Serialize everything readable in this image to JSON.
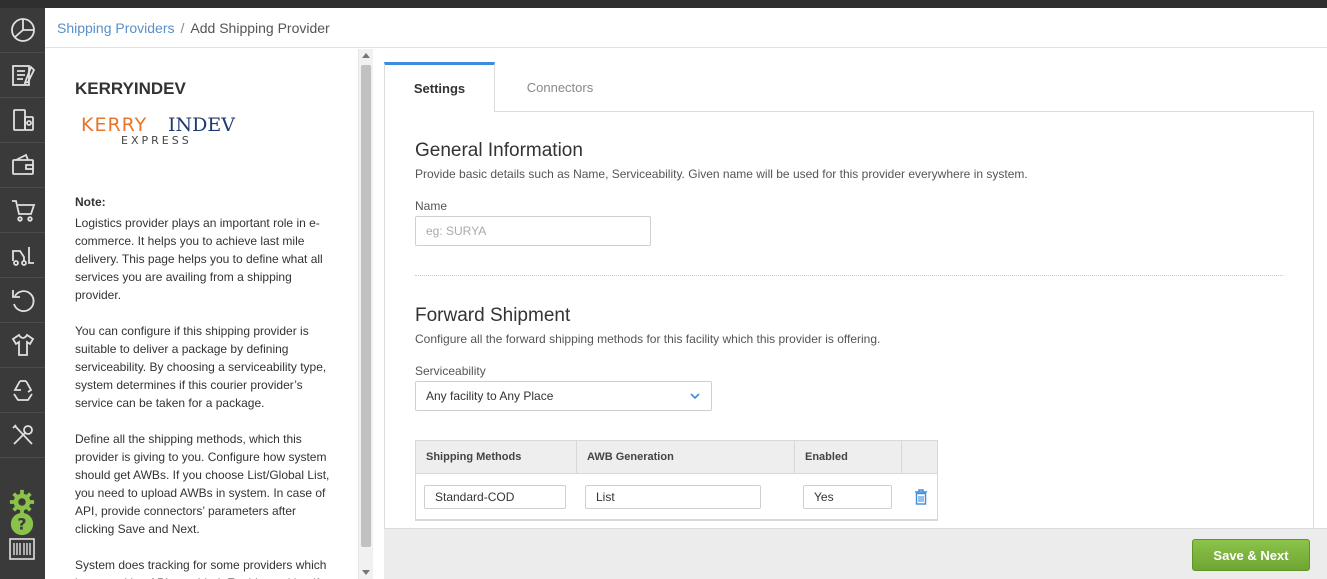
{
  "breadcrumb": {
    "parent": "Shipping Providers",
    "separator": "/",
    "current": "Add Shipping Provider"
  },
  "sidebar_icons": [
    "dashboard-icon",
    "orders-icon",
    "shipping-icon",
    "payments-icon",
    "cart-icon",
    "forklift-icon",
    "returns-icon",
    "shirt-icon",
    "recycle-icon",
    "tools-icon",
    "settings-icon",
    "help-icon",
    "barcode-icon"
  ],
  "info": {
    "provider_name": "KERRYINDEV",
    "logo_text_top": "KERRYINDEV",
    "logo_text_bottom": "EXPRESS",
    "note_title": "Note:",
    "paragraphs": [
      "Logistics provider plays an important role in e-commerce. It helps you to achieve last mile delivery. This page helps you to define what all services you are availing from a shipping provider.",
      "You can configure if this shipping provider is suitable to deliver a package by defining serviceability. By choosing a serviceability type, system determines if this courier provider’s service can be taken for a package.",
      "Define all the shipping methods, which this provider is giving to you. Configure how system should get AWBs. If you choose List/Global List, you need to upload AWBs in system. In case of API, provide connectors’ parameters after clicking Save and Next.",
      "System does tracking for some providers which have tracking APIs enabled. Enable tracking if"
    ]
  },
  "tabs": {
    "settings": "Settings",
    "connectors": "Connectors"
  },
  "general": {
    "title": "General Information",
    "description": "Provide basic details such as Name, Serviceability. Given name will be used for this provider everywhere in system.",
    "name_label": "Name",
    "name_placeholder": "eg: SURYA"
  },
  "forward": {
    "title": "Forward Shipment",
    "description": "Configure all the forward shipping methods for this facility which this provider is offering.",
    "serviceability_label": "Serviceability",
    "serviceability_value": "Any facility to Any Place"
  },
  "methods_table": {
    "headers": [
      "Shipping Methods",
      "AWB Generation",
      "Enabled"
    ],
    "rows": [
      {
        "method": "Standard-COD",
        "awb": "List",
        "enabled": "Yes"
      }
    ]
  },
  "footer": {
    "save_label": "Save & Next"
  },
  "colors": {
    "rail": "#3a3a3a",
    "link": "#5a8fc8",
    "tab_accent": "#3c8dde",
    "save_button": "#7cb342",
    "logo_orange": "#e8752a",
    "logo_navy": "#1f3a6e"
  }
}
